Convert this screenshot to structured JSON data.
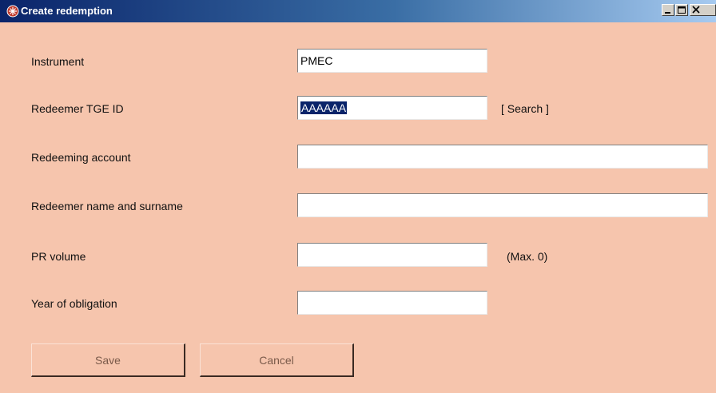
{
  "window": {
    "title": "Create redemption",
    "icon": "app-icon",
    "controls": [
      "minimize",
      "maximize",
      "close"
    ]
  },
  "form": {
    "instrument": {
      "label": "Instrument",
      "value": "PMEC"
    },
    "tge_id": {
      "label": "Redeemer TGE ID",
      "value": "AAAAAA",
      "search_link": "[ Search ]"
    },
    "account": {
      "label": "Redeeming account",
      "value": ""
    },
    "name": {
      "label": "Redeemer name and surname",
      "value": ""
    },
    "pr_volume": {
      "label": "PR volume",
      "value": "",
      "max_hint": "(Max. 0)"
    },
    "year": {
      "label": "Year of obligation",
      "value": ""
    }
  },
  "buttons": {
    "save": "Save",
    "cancel": "Cancel"
  },
  "colors": {
    "background": "#f6c5ad",
    "titlebar_start": "#0a246a",
    "titlebar_end": "#a6caf0",
    "selection": "#0a246a"
  }
}
